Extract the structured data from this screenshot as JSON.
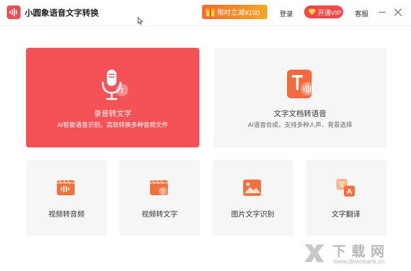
{
  "app": {
    "title": "小圆象语音文字转换"
  },
  "header": {
    "promo_label": "限时立减¥100",
    "login_label": "登录",
    "vip_label": "开通VIP",
    "service_label": "客服"
  },
  "features": {
    "main": [
      {
        "title": "录音转文字",
        "desc": "AI智能语音识别，高效转换多种音频文件",
        "icon": "microphone-icon"
      },
      {
        "title": "文字文档转语音",
        "desc": "AI语音合成，支持多种人声、背景选择",
        "icon": "text-to-speech-icon"
      }
    ],
    "tools": [
      {
        "title": "视频转音频",
        "icon": "video-audio-icon"
      },
      {
        "title": "视频转文字",
        "icon": "video-text-icon"
      },
      {
        "title": "图片文字识别",
        "icon": "image-ocr-icon"
      },
      {
        "title": "文字翻译",
        "icon": "translate-icon"
      }
    ]
  },
  "watermark": {
    "title": "下载网",
    "url": "www.downbank.cn"
  },
  "colors": {
    "accent": "#f45257",
    "promo": "#f46a34",
    "vip": "#f24848"
  }
}
